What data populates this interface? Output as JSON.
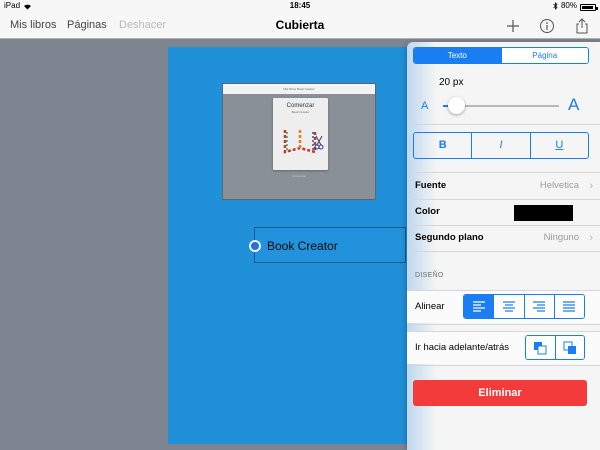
{
  "status_bar": {
    "device": "iPad",
    "time": "18:45",
    "battery": "80%"
  },
  "nav": {
    "my_books": "Mis libros",
    "pages": "Páginas",
    "undo": "Deshacer",
    "title": "Cubierta",
    "icons": {
      "add": "plus-icon",
      "info": "info-icon",
      "share": "share-icon"
    }
  },
  "canvas": {
    "thumbnail": {
      "topbar": "Mis libros  Book Creator",
      "book_title": "Comenzar",
      "book_subtitle": "Book Creator",
      "caption": "Comenzar"
    },
    "text_box": "Book Creator"
  },
  "inspector": {
    "tabs": [
      {
        "label": "Texto",
        "active": true
      },
      {
        "label": "Página",
        "active": false
      }
    ],
    "font_size": "20 px",
    "slider": {
      "min_label": "A",
      "max_label": "A",
      "level": 0.12
    },
    "style_buttons": {
      "bold": "B",
      "italic": "I",
      "underline": "U"
    },
    "rows": {
      "font": {
        "label": "Fuente",
        "value": "Helvetica"
      },
      "color": {
        "label": "Color",
        "value": "#000000"
      },
      "background": {
        "label": "Segundo plano",
        "value": "Ninguno"
      }
    },
    "section_design": "DISEÑO",
    "align": {
      "label": "Alinear",
      "options": [
        "align-left-icon",
        "align-center-icon",
        "align-right-icon",
        "justify-icon"
      ],
      "selected": 0
    },
    "layer": {
      "label": "Ir hacia adelante/atrás",
      "options": [
        "send-backward-icon",
        "bring-forward-icon"
      ]
    },
    "delete": "Eliminar"
  },
  "colors": {
    "accent": "#1a7ef2",
    "page_background": "#2090d9",
    "delete": "#f43b3b"
  }
}
